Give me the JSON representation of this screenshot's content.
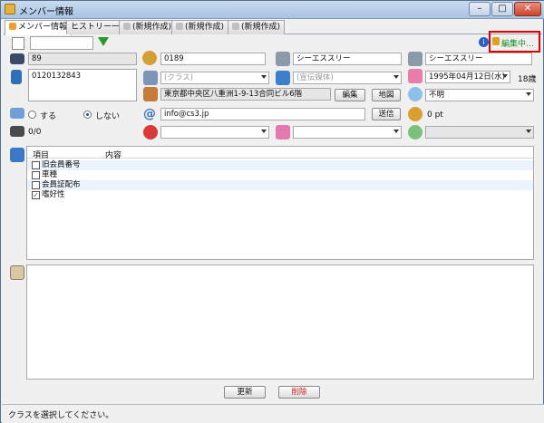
{
  "window": {
    "title": "メンバー情報",
    "buttons": {
      "minimize": "–",
      "maximize": "□",
      "close": "✕"
    }
  },
  "tabs": [
    {
      "label": "メンバー情報"
    },
    {
      "label": "ヒストリー一覧"
    },
    {
      "label": "(新規作成)"
    },
    {
      "label": "(新規作成)"
    },
    {
      "label": "(新規作成)"
    }
  ],
  "toolbar": {
    "edit_status": "編集中…",
    "info_icon": "info-icon"
  },
  "fields": {
    "id": "89",
    "member_no": "0189",
    "name_kana1": "シーエススリー",
    "name_kana2": "シーエススリー",
    "phone": "0120132843",
    "class_placeholder": "(クラス)",
    "media_placeholder": "(宣伝媒体)",
    "birthday": "1995年04月12日(水)",
    "age": "18歳",
    "address": "東京都中央区八重洲1-9-13合同ビル6階",
    "address_edit": "編集",
    "address_map": "地図",
    "blood_type": "不明",
    "mail_yes": "する",
    "mail_no": "しない",
    "email": "info@cs3.jp",
    "send": "送信",
    "points": "0 pt",
    "counter": "0/0"
  },
  "list": {
    "headers": [
      "項目",
      "内容"
    ],
    "rows": [
      {
        "label": "旧会員番号",
        "checked": false
      },
      {
        "label": "車種",
        "checked": false
      },
      {
        "label": "会員証配布",
        "checked": false
      },
      {
        "label": "嗜好性",
        "checked": true
      }
    ]
  },
  "buttons": {
    "update": "更新",
    "delete": "削除"
  },
  "status_bar": "クラスを選択してください。"
}
